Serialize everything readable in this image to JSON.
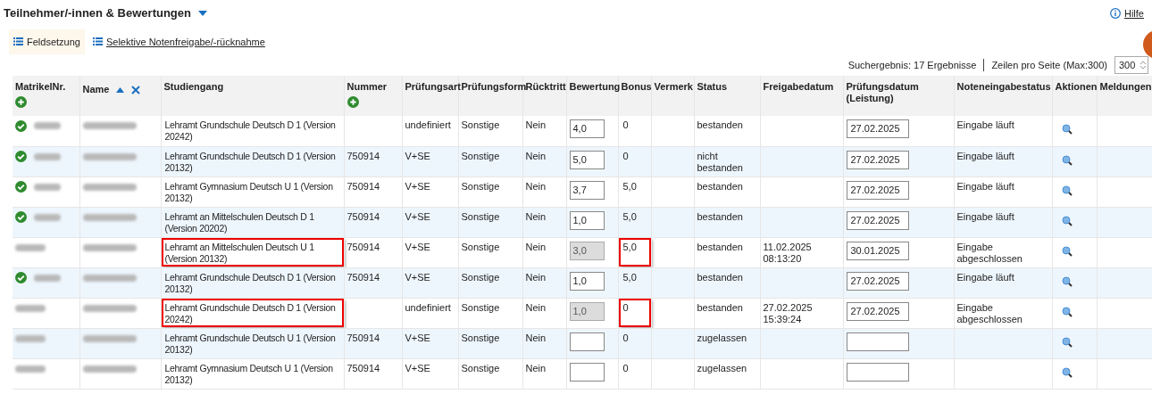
{
  "title": "Teilnehmer/-innen & Bewertungen",
  "help": "Hilfe",
  "toolbar": [
    {
      "label": "Feldsetzung",
      "selected": true
    },
    {
      "label": "Selektive Notenfreigabe/-rücknahme",
      "selected": false
    }
  ],
  "search_result": "Suchergebnis: 17 Ergebnisse",
  "rows_per_page_label": "Zeilen pro Seite (Max:300)",
  "rows_per_page": "300",
  "columns": [
    {
      "label": "MatrikelNr.",
      "kind": "add"
    },
    {
      "label": "Name",
      "kind": "sort"
    },
    {
      "label": "Studiengang",
      "kind": "plain"
    },
    {
      "label": "Nummer",
      "kind": "add"
    },
    {
      "label": "Prüfungsart",
      "kind": "plain"
    },
    {
      "label": "Prüfungsform",
      "kind": "plain"
    },
    {
      "label": "Rücktritt",
      "kind": "plain"
    },
    {
      "label": "Bewertung",
      "kind": "plain"
    },
    {
      "label": "Bonus",
      "kind": "plain"
    },
    {
      "label": "Vermerk",
      "kind": "plain"
    },
    {
      "label": "Status",
      "kind": "plain"
    },
    {
      "label": "Freigabedatum",
      "kind": "plain"
    },
    {
      "label": "Prüfungsdatum (Leistung)",
      "kind": "plain"
    },
    {
      "label": "Noteneingabestatus",
      "kind": "plain"
    },
    {
      "label": "Aktionen",
      "kind": "plain"
    },
    {
      "label": "Meldungen",
      "kind": "plain"
    }
  ],
  "rows": [
    {
      "verified": true,
      "course": "Lehramt Grundschule Deutsch D 1 (Version 20242)",
      "course_highlighted": false,
      "number": "",
      "exam_type": "undefiniert",
      "exam_form": "Sonstige",
      "withdrawal": "Nein",
      "grade": "4,0",
      "grade_locked": false,
      "bonus": "0",
      "bonus_highlighted": false,
      "status": "bestanden",
      "release_date": "",
      "exam_date": "27.02.2025",
      "entry_status": "Eingabe läuft"
    },
    {
      "verified": true,
      "course": "Lehramt Grundschule Deutsch D 1 (Version 20132)",
      "course_highlighted": false,
      "number": "750914",
      "exam_type": "V+SE",
      "exam_form": "Sonstige",
      "withdrawal": "Nein",
      "grade": "5,0",
      "grade_locked": false,
      "bonus": "0",
      "bonus_highlighted": false,
      "status": "nicht bestanden",
      "release_date": "",
      "exam_date": "27.02.2025",
      "entry_status": "Eingabe läuft"
    },
    {
      "verified": true,
      "course": "Lehramt Gymnasium Deutsch U 1 (Version 20132)",
      "course_highlighted": false,
      "number": "750914",
      "exam_type": "V+SE",
      "exam_form": "Sonstige",
      "withdrawal": "Nein",
      "grade": "3,7",
      "grade_locked": false,
      "bonus": "5,0",
      "bonus_highlighted": false,
      "status": "bestanden",
      "release_date": "",
      "exam_date": "27.02.2025",
      "entry_status": "Eingabe läuft"
    },
    {
      "verified": true,
      "course": "Lehramt an Mittelschulen Deutsch D 1 (Version 20202)",
      "course_highlighted": false,
      "number": "750914",
      "exam_type": "V+SE",
      "exam_form": "Sonstige",
      "withdrawal": "Nein",
      "grade": "1,0",
      "grade_locked": false,
      "bonus": "5,0",
      "bonus_highlighted": false,
      "status": "bestanden",
      "release_date": "",
      "exam_date": "27.02.2025",
      "entry_status": "Eingabe läuft"
    },
    {
      "verified": false,
      "course": "Lehramt an Mittelschulen Deutsch U 1 (Version 20132)",
      "course_highlighted": true,
      "number": "750914",
      "exam_type": "V+SE",
      "exam_form": "Sonstige",
      "withdrawal": "Nein",
      "grade": "3,0",
      "grade_locked": true,
      "bonus": "5,0",
      "bonus_highlighted": true,
      "status": "bestanden",
      "release_date": "11.02.2025 08:13:20",
      "exam_date": "30.01.2025",
      "entry_status": "Eingabe abgeschlossen"
    },
    {
      "verified": true,
      "course": "Lehramt Grundschule Deutsch D 1 (Version 20132)",
      "course_highlighted": false,
      "number": "750914",
      "exam_type": "V+SE",
      "exam_form": "Sonstige",
      "withdrawal": "Nein",
      "grade": "1,0",
      "grade_locked": false,
      "bonus": "5,0",
      "bonus_highlighted": false,
      "status": "bestanden",
      "release_date": "",
      "exam_date": "27.02.2025",
      "entry_status": "Eingabe läuft"
    },
    {
      "verified": false,
      "course": "Lehramt Grundschule Deutsch D 1 (Version 20242)",
      "course_highlighted": true,
      "number": "",
      "exam_type": "undefiniert",
      "exam_form": "Sonstige",
      "withdrawal": "Nein",
      "grade": "1,0",
      "grade_locked": true,
      "bonus": "0",
      "bonus_highlighted": true,
      "status": "bestanden",
      "release_date": "27.02.2025 15:39:24",
      "exam_date": "27.02.2025",
      "entry_status": "Eingabe abgeschlossen"
    },
    {
      "verified": false,
      "course": "Lehramt Grundschule Deutsch U 1 (Version 20132)",
      "course_highlighted": false,
      "number": "750914",
      "exam_type": "V+SE",
      "exam_form": "Sonstige",
      "withdrawal": "Nein",
      "grade": "",
      "grade_locked": false,
      "bonus": "0",
      "bonus_highlighted": false,
      "status": "zugelassen",
      "release_date": "",
      "exam_date": "",
      "entry_status": ""
    },
    {
      "verified": false,
      "course": "Lehramt Gymnasium Deutsch U 1 (Version 20132)",
      "course_highlighted": false,
      "number": "750914",
      "exam_type": "V+SE",
      "exam_form": "Sonstige",
      "withdrawal": "Nein",
      "grade": "",
      "grade_locked": false,
      "bonus": "0",
      "bonus_highlighted": false,
      "status": "zugelassen",
      "release_date": "",
      "exam_date": "",
      "entry_status": ""
    }
  ]
}
